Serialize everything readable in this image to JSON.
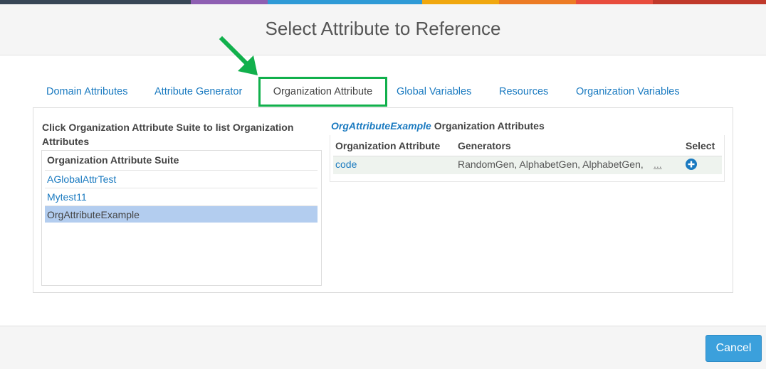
{
  "top_bar_colors": [
    "#384656",
    "#8e5fb2",
    "#2f9ad6",
    "#2f9ad6",
    "#f0a70f",
    "#ec7b24",
    "#e84c3d",
    "#c0392b"
  ],
  "dialog": {
    "title": "Select Attribute to Reference"
  },
  "tabs": [
    {
      "label": "Domain Attributes"
    },
    {
      "label": "Attribute Generator"
    },
    {
      "label": "Organization Attribute"
    },
    {
      "label": "Global Variables"
    },
    {
      "label": "Resources"
    },
    {
      "label": "Organization Variables"
    }
  ],
  "active_tab_index": 2,
  "left_panel": {
    "title": "Click Organization Attribute Suite to list Organization Attributes",
    "column_header": "Organization Attribute Suite",
    "items": [
      {
        "label": "AGlobalAttrTest"
      },
      {
        "label": "Mytest11"
      },
      {
        "label": "OrgAttributeExample"
      }
    ],
    "selected_index": 2
  },
  "right_panel": {
    "title_suite": "OrgAttributeExample",
    "title_suffix": "Organization Attributes",
    "headers": {
      "attribute": "Organization Attribute",
      "generators": "Generators",
      "select": "Select"
    },
    "rows": [
      {
        "attribute": "code",
        "generators": "RandomGen, AlphabetGen, AlphabetGen,",
        "more": "...",
        "select_icon": "plus-circle-icon"
      }
    ]
  },
  "footer": {
    "cancel_label": "Cancel"
  },
  "colors": {
    "accent": "#1a7ac0",
    "highlight_border": "#11b04c",
    "annotation_arrow": "#11b04c",
    "selected_row": "#b3cdef",
    "cancel_button": "#3ba0dc"
  }
}
